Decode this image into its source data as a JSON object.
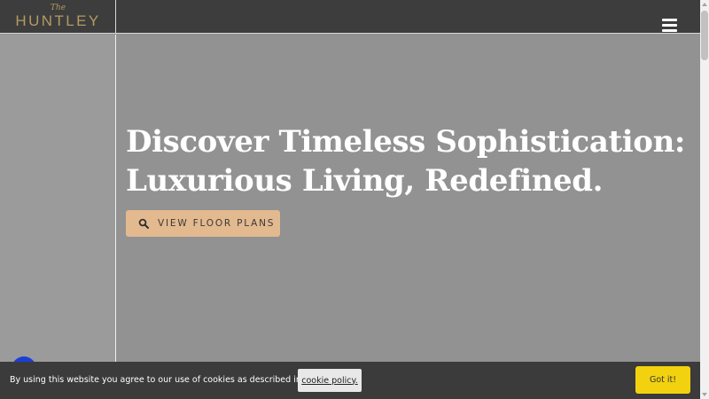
{
  "header": {
    "logo_the": "The",
    "logo_name": "HUNTLEY",
    "menu_icon": "hamburger-menu-icon"
  },
  "hero": {
    "title": "Discover Timeless Sophistication: Luxurious Living, Redefined.",
    "cta_label": "VIEW FLOOR PLANS",
    "cta_icon": "search-icon"
  },
  "cookie": {
    "message": "By using this website you agree to our use of cookies as described in our",
    "link_label": "cookie policy.",
    "accept_label": "Got it!"
  },
  "colors": {
    "header_bg": "#3d3d3d",
    "hero_overlay": "#929292",
    "logo_gold": "#b59a62",
    "cta_bg": "#e3b98f",
    "cookie_bar_bg": "#3b3b3b",
    "accept_bg": "#f2d20f",
    "chat_bubble": "#1a3fd8"
  }
}
